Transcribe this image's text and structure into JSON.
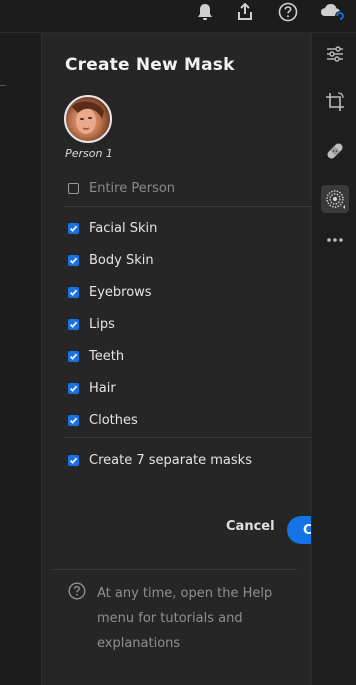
{
  "panel": {
    "title": "Create New Mask",
    "person_label": "Person 1",
    "entire_person_label": "Entire Person",
    "options": [
      {
        "label": "Facial Skin",
        "checked": true
      },
      {
        "label": "Body Skin",
        "checked": true
      },
      {
        "label": "Eyebrows",
        "checked": true
      },
      {
        "label": "Lips",
        "checked": true
      },
      {
        "label": "Teeth",
        "checked": true
      },
      {
        "label": "Hair",
        "checked": true
      },
      {
        "label": "Clothes",
        "checked": true
      }
    ],
    "separate_masks_label": "Create 7 separate masks",
    "cancel_label": "Cancel",
    "create_label": "C",
    "help_text": "At any time, open the Help menu for tutorials and explanations"
  },
  "colors": {
    "accent": "#1473e6",
    "panel_bg": "#262626",
    "toolbar_bg": "#1e1e1e"
  },
  "icons": {
    "topbar": [
      "bell-icon",
      "share-icon",
      "help-icon",
      "cloud-sync-icon"
    ],
    "toolbar": [
      "sliders-icon",
      "crop-icon",
      "healing-bandage-icon",
      "masking-icon",
      "more-icon"
    ]
  }
}
